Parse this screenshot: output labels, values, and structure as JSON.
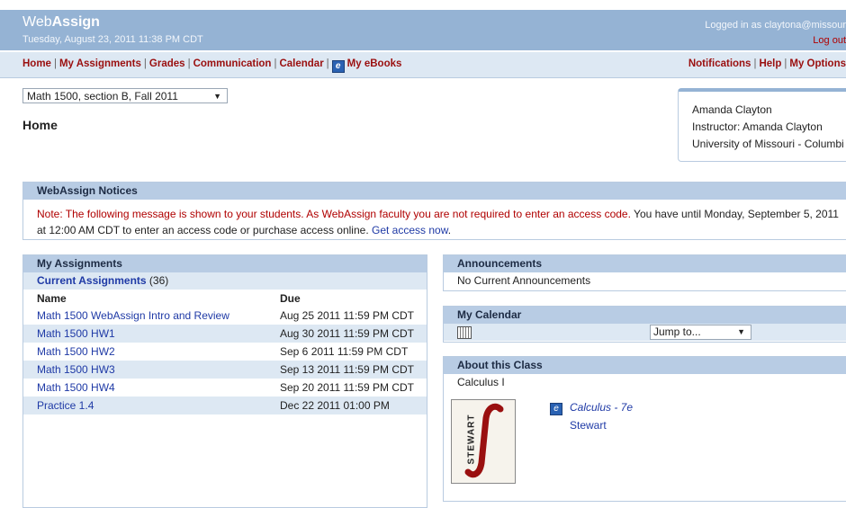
{
  "header": {
    "brand_light": "Web",
    "brand_bold": "Assign",
    "date": "Tuesday, August 23, 2011 11:38 PM CDT",
    "logged_in": "Logged in as claytona@missour",
    "logout": "Log out"
  },
  "nav": {
    "left": [
      "Home",
      "My Assignments",
      "Grades",
      "Communication",
      "Calendar"
    ],
    "ebooks": "My eBooks",
    "right": [
      "Notifications",
      "Help",
      "My Options"
    ]
  },
  "course": {
    "selected": "Math 1500, section B, Fall 2011"
  },
  "page_title": "Home",
  "user": {
    "name": "Amanda Clayton",
    "role": "Instructor: Amanda Clayton",
    "school": "University of Missouri - Columbi"
  },
  "notices": {
    "title": "WebAssign Notices",
    "red_text": "Note: The following message is shown to your students. As WebAssign faculty you are not required to enter an access code.",
    "text": " You have until Monday, September 5, 2011 at 12:00 AM CDT to enter an access code or purchase access online. ",
    "link": "Get access now",
    "end": "."
  },
  "assignments": {
    "title": "My Assignments",
    "current_label": "Current Assignments",
    "current_count": "(36)",
    "col_name": "Name",
    "col_due": "Due",
    "rows": [
      {
        "name": "Math 1500 WebAssign Intro and Review",
        "due": "Aug 25 2011 11:59 PM CDT"
      },
      {
        "name": "Math 1500 HW1",
        "due": "Aug 30 2011 11:59 PM CDT"
      },
      {
        "name": "Math 1500 HW2",
        "due": "Sep 6 2011 11:59 PM CDT"
      },
      {
        "name": "Math 1500 HW3",
        "due": "Sep 13 2011 11:59 PM CDT"
      },
      {
        "name": "Math 1500 HW4",
        "due": "Sep 20 2011 11:59 PM CDT"
      },
      {
        "name": "Practice 1.4",
        "due": "Dec 22 2011 01:00 PM"
      }
    ]
  },
  "announcements": {
    "title": "Announcements",
    "text": "No Current Announcements"
  },
  "calendar": {
    "title": "My Calendar",
    "jump": "Jump to..."
  },
  "about": {
    "title": "About this Class",
    "course": "Calculus I",
    "book_title": "Calculus - 7e",
    "book_author": "Stewart",
    "cover_text": "STEWART"
  },
  "colors": {
    "header": "#95b3d4",
    "nav_text": "#9a0f0f",
    "link": "#1f3aa6",
    "panel_head": "#b8cce4",
    "alt_row": "#dde8f3"
  }
}
